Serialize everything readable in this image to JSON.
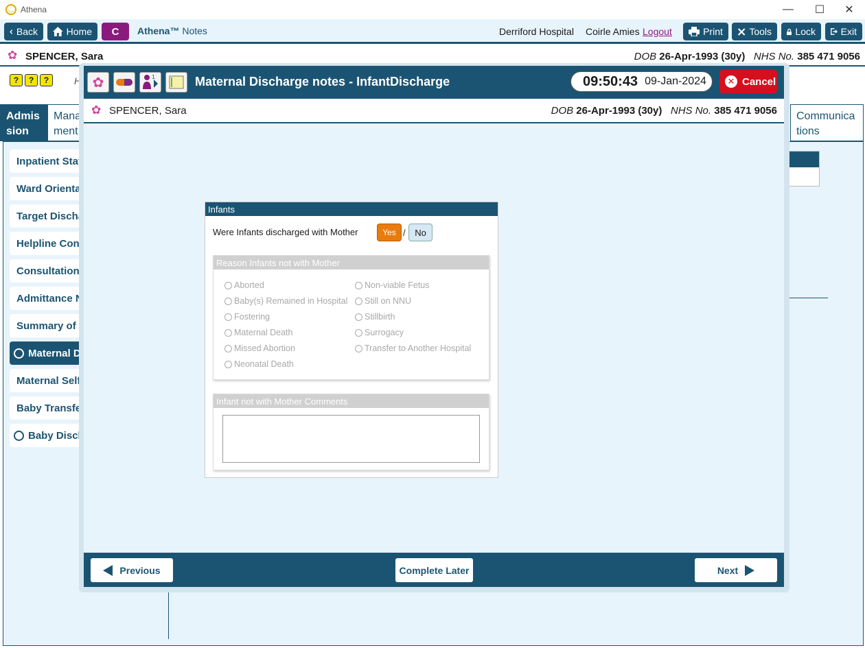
{
  "window": {
    "title": "Athena"
  },
  "toolbar": {
    "back": "Back",
    "home": "Home",
    "c_label": "C",
    "brand_name": "Athena™",
    "brand_suffix": "Notes",
    "hospital": "Derriford Hospital",
    "user": "Coirle Amies",
    "logout": "Logout",
    "print": "Print",
    "tools": "Tools",
    "lock": "Lock",
    "exit": "Exit"
  },
  "patient": {
    "name": "SPENCER, Sara",
    "dob_label": "DOB",
    "dob": "26-Apr-1993 (30y)",
    "nhs_label": "NHS No.",
    "nhs": "385 471 9056"
  },
  "background": {
    "help_icons": [
      "?",
      "?",
      "?"
    ],
    "partial_h": "H",
    "tabs": [
      {
        "l1": "Admis",
        "l2": "sion"
      },
      {
        "l1": "Mana",
        "l2": "ment"
      },
      {
        "l1": "Communica",
        "l2": "tions"
      }
    ],
    "nav_items": [
      "Inpatient Stay",
      "Ward Orientat",
      "Target Dischar",
      "Helpline Cont",
      "Consultation I",
      "Admittance N",
      "Summary of P",
      "Maternal Di",
      "Maternal Self",
      "Baby Transfer",
      "Baby Discha"
    ]
  },
  "modal": {
    "title": "Maternal Discharge notes - InfantDischarge",
    "time": "09:50:43",
    "date": "09-Jan-2024",
    "cancel": "Cancel",
    "footer": {
      "previous": "Previous",
      "complete_later": "Complete Later",
      "next": "Next"
    }
  },
  "form": {
    "section_title": "Infants",
    "question": "Were Infants discharged with Mother",
    "yes": "Yes",
    "sep": "/",
    "no": "No",
    "reason_group": {
      "title": "Reason Infants not with Mother",
      "options_left": [
        "Aborted",
        "Baby(s) Remained in Hospital",
        "Fostering",
        "Maternal Death",
        "Missed Abortion",
        "Neonatal Death"
      ],
      "options_right": [
        "Non-viable Fetus",
        "Still on NNU",
        "Stillbirth",
        "Surrogacy",
        "Transfer to Another Hospital"
      ]
    },
    "comments_group": {
      "title": "Infant not with Mother Comments",
      "value": ""
    }
  }
}
